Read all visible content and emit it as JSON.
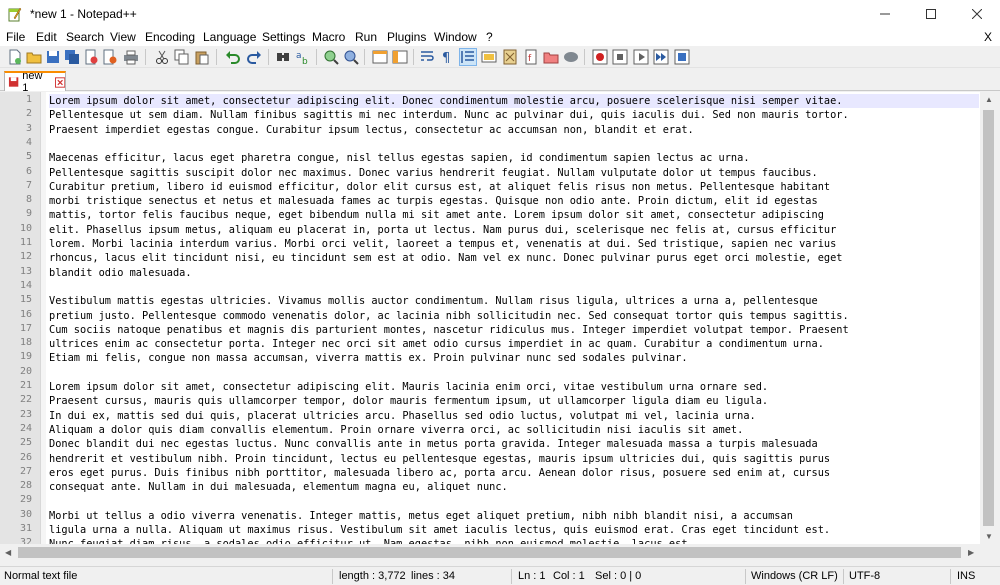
{
  "window": {
    "title": "*new 1 - Notepad++",
    "min_icon": "minimize-icon",
    "max_icon": "maximize-icon",
    "close_icon": "close-icon"
  },
  "menu": {
    "items": [
      "File",
      "Edit",
      "Search",
      "View",
      "Encoding",
      "Language",
      "Settings",
      "Macro",
      "Run",
      "Plugins",
      "Window",
      "?"
    ],
    "close_label": "X"
  },
  "toolbar": {
    "icons": [
      "new-file-icon",
      "open-file-icon",
      "save-icon",
      "save-all-icon",
      "close-icon",
      "close-all-icon",
      "print-icon",
      "cut-icon",
      "copy-icon",
      "paste-icon",
      "undo-icon",
      "redo-icon",
      "find-icon",
      "replace-icon",
      "zoom-in-icon",
      "zoom-out-icon",
      "sync-vertical-icon",
      "sync-horizontal-icon",
      "word-wrap-icon",
      "show-all-chars-icon",
      "indent-guide-icon",
      "udl-icon",
      "doc-map-icon",
      "function-list-icon",
      "folder-workspace-icon",
      "monitoring-icon",
      "record-macro-icon",
      "stop-record-icon",
      "play-macro-icon",
      "run-macro-multiple-icon",
      "save-macro-icon"
    ]
  },
  "tabs": [
    {
      "label": "new 1",
      "icon": "unsaved-file-icon",
      "close_icon": "tab-close-icon"
    }
  ],
  "editor": {
    "current_line": 1,
    "lines": [
      "Lorem ipsum dolor sit amet, consectetur adipiscing elit. Donec condimentum molestie arcu, posuere scelerisque nisi semper vitae.",
      "Pellentesque ut sem diam. Nullam finibus sagittis mi nec interdum. Nunc ac pulvinar dui, quis iaculis dui. Sed non mauris tortor.",
      "Praesent imperdiet egestas congue. Curabitur ipsum lectus, consectetur ac accumsan non, blandit et erat.",
      "",
      "Maecenas efficitur, lacus eget pharetra congue, nisl tellus egestas sapien, id condimentum sapien lectus ac urna.",
      "Pellentesque sagittis suscipit dolor nec maximus. Donec varius hendrerit feugiat. Nullam vulputate dolor ut tempus faucibus.",
      "Curabitur pretium, libero id euismod efficitur, dolor elit cursus est, at aliquet felis risus non metus. Pellentesque habitant",
      "morbi tristique senectus et netus et malesuada fames ac turpis egestas. Quisque non odio ante. Proin dictum, elit id egestas",
      "mattis, tortor felis faucibus neque, eget bibendum nulla mi sit amet ante. Lorem ipsum dolor sit amet, consectetur adipiscing",
      "elit. Phasellus ipsum metus, aliquam eu placerat in, porta ut lectus. Nam purus dui, scelerisque nec felis at, cursus efficitur",
      "lorem. Morbi lacinia interdum varius. Morbi orci velit, laoreet a tempus et, venenatis at dui. Sed tristique, sapien nec varius",
      "rhoncus, lacus elit tincidunt nisi, eu tincidunt sem est at odio. Nam vel ex nunc. Donec pulvinar purus eget orci molestie, eget",
      "blandit odio malesuada.",
      "",
      "Vestibulum mattis egestas ultricies. Vivamus mollis auctor condimentum. Nullam risus ligula, ultrices a urna a, pellentesque",
      "pretium justo. Pellentesque commodo venenatis dolor, ac lacinia nibh sollicitudin nec. Sed consequat tortor quis tempus sagittis.",
      "Cum sociis natoque penatibus et magnis dis parturient montes, nascetur ridiculus mus. Integer imperdiet volutpat tempor. Praesent",
      "ultrices enim ac consectetur porta. Integer nec orci sit amet odio cursus imperdiet in ac quam. Curabitur a condimentum urna.",
      "Etiam mi felis, congue non massa accumsan, viverra mattis ex. Proin pulvinar nunc sed sodales pulvinar.",
      "",
      "Lorem ipsum dolor sit amet, consectetur adipiscing elit. Mauris lacinia enim orci, vitae vestibulum urna ornare sed.",
      "Praesent cursus, mauris quis ullamcorper tempor, dolor mauris fermentum ipsum, ut ullamcorper ligula diam eu ligula.",
      "In dui ex, mattis sed dui quis, placerat ultricies arcu. Phasellus sed odio luctus, volutpat mi vel, lacinia urna.",
      "Aliquam a dolor quis diam convallis elementum. Proin ornare viverra orci, ac sollicitudin nisi iaculis sit amet.",
      "Donec blandit dui nec egestas luctus. Nunc convallis ante in metus porta gravida. Integer malesuada massa a turpis malesuada",
      "hendrerit et vestibulum nibh. Proin tincidunt, lectus eu pellentesque egestas, mauris ipsum ultricies dui, quis sagittis purus",
      "eros eget purus. Duis finibus nibh porttitor, malesuada libero ac, porta arcu. Aenean dolor risus, posuere sed enim at, cursus",
      "consequat ante. Nullam in dui malesuada, elementum magna eu, aliquet nunc.",
      "",
      "Morbi ut tellus a odio viverra venenatis. Integer mattis, metus eget aliquet pretium, nibh nibh blandit nisi, a accumsan",
      "ligula urna a nulla. Aliquam ut maximus risus. Vestibulum sit amet iaculis lectus, quis euismod erat. Cras eget tincidunt est.",
      "Nunc feugiat diam risus, a sodales odio efficitur ut. Nam egestas, nibh non euismod molestie, lacus est"
    ]
  },
  "status": {
    "file_type": "Normal text file",
    "length": "length : 3,772",
    "lines": "lines : 34",
    "ln": "Ln : 1",
    "col": "Col : 1",
    "sel": "Sel : 0 | 0",
    "eol": "Windows (CR LF)",
    "encoding": "UTF-8",
    "mode": "INS"
  },
  "colors": {
    "current_line": "#e8e8ff",
    "tab_accent": "#fa8c00",
    "gutter": "#e4e4e4"
  }
}
